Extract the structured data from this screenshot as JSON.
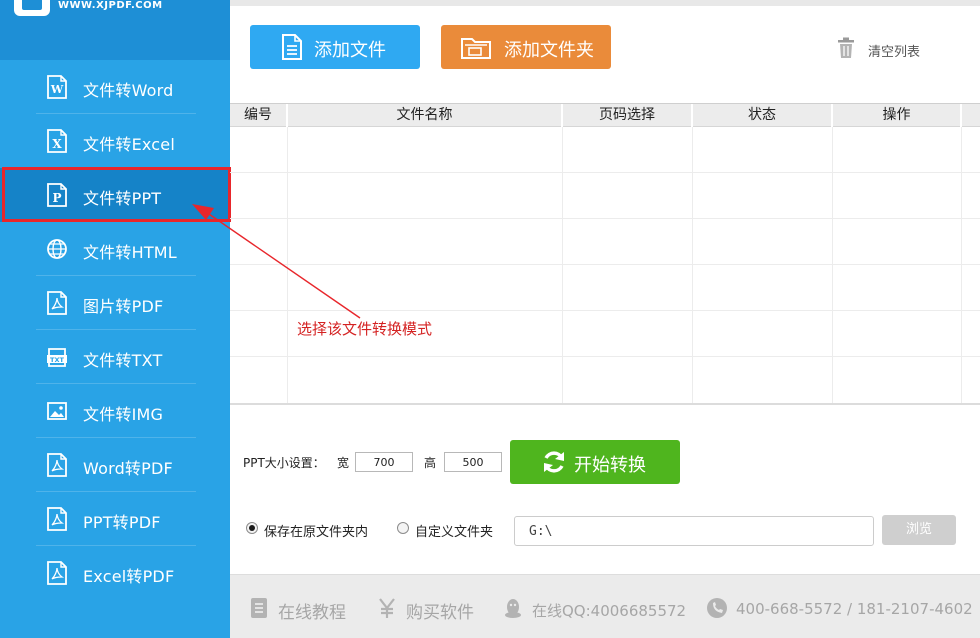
{
  "logo": {
    "url_text": "WWW.XJPDF.COM"
  },
  "sidebar": {
    "items": [
      {
        "label": "文件转Word",
        "icon": "word-doc-icon"
      },
      {
        "label": "文件转Excel",
        "icon": "excel-doc-icon"
      },
      {
        "label": "文件转PPT",
        "icon": "ppt-doc-icon",
        "selected": true
      },
      {
        "label": "文件转HTML",
        "icon": "globe-icon"
      },
      {
        "label": "图片转PDF",
        "icon": "pdf-doc-icon"
      },
      {
        "label": "文件转TXT",
        "icon": "txt-icon"
      },
      {
        "label": "文件转IMG",
        "icon": "image-icon"
      },
      {
        "label": "Word转PDF",
        "icon": "pdf-doc-icon"
      },
      {
        "label": "PPT转PDF",
        "icon": "pdf-doc-icon"
      },
      {
        "label": "Excel转PDF",
        "icon": "pdf-doc-icon"
      }
    ]
  },
  "toolbar": {
    "add_file": "添加文件",
    "add_folder": "添加文件夹",
    "clear_list": "清空列表"
  },
  "table": {
    "columns": [
      "编号",
      "文件名称",
      "页码选择",
      "状态",
      "操作"
    ],
    "rows": []
  },
  "annotation": {
    "text": "选择该文件转换模式"
  },
  "settings": {
    "ppt_size_label": "PPT大小设置：",
    "width_label": "宽",
    "width_value": "700",
    "height_label": "高",
    "height_value": "500",
    "start_button": "开始转换",
    "save_original_label": "保存在原文件夹内",
    "save_original_checked": true,
    "custom_folder_label": "自定义文件夹",
    "path_value": "G:\\",
    "browse_button": "浏览"
  },
  "footer": {
    "tutorial": "在线教程",
    "buy": "购买软件",
    "qq": "在线QQ:4006685572",
    "phone": "400-668-5572 / 181-2107-4602"
  },
  "colors": {
    "sidebar": "#29a3e6",
    "selected": "#1583c8",
    "add_file_button": "#2fa9f2",
    "add_folder_button": "#ea8b3a",
    "start_button": "#4fb51e",
    "highlight": "#e8262b"
  }
}
